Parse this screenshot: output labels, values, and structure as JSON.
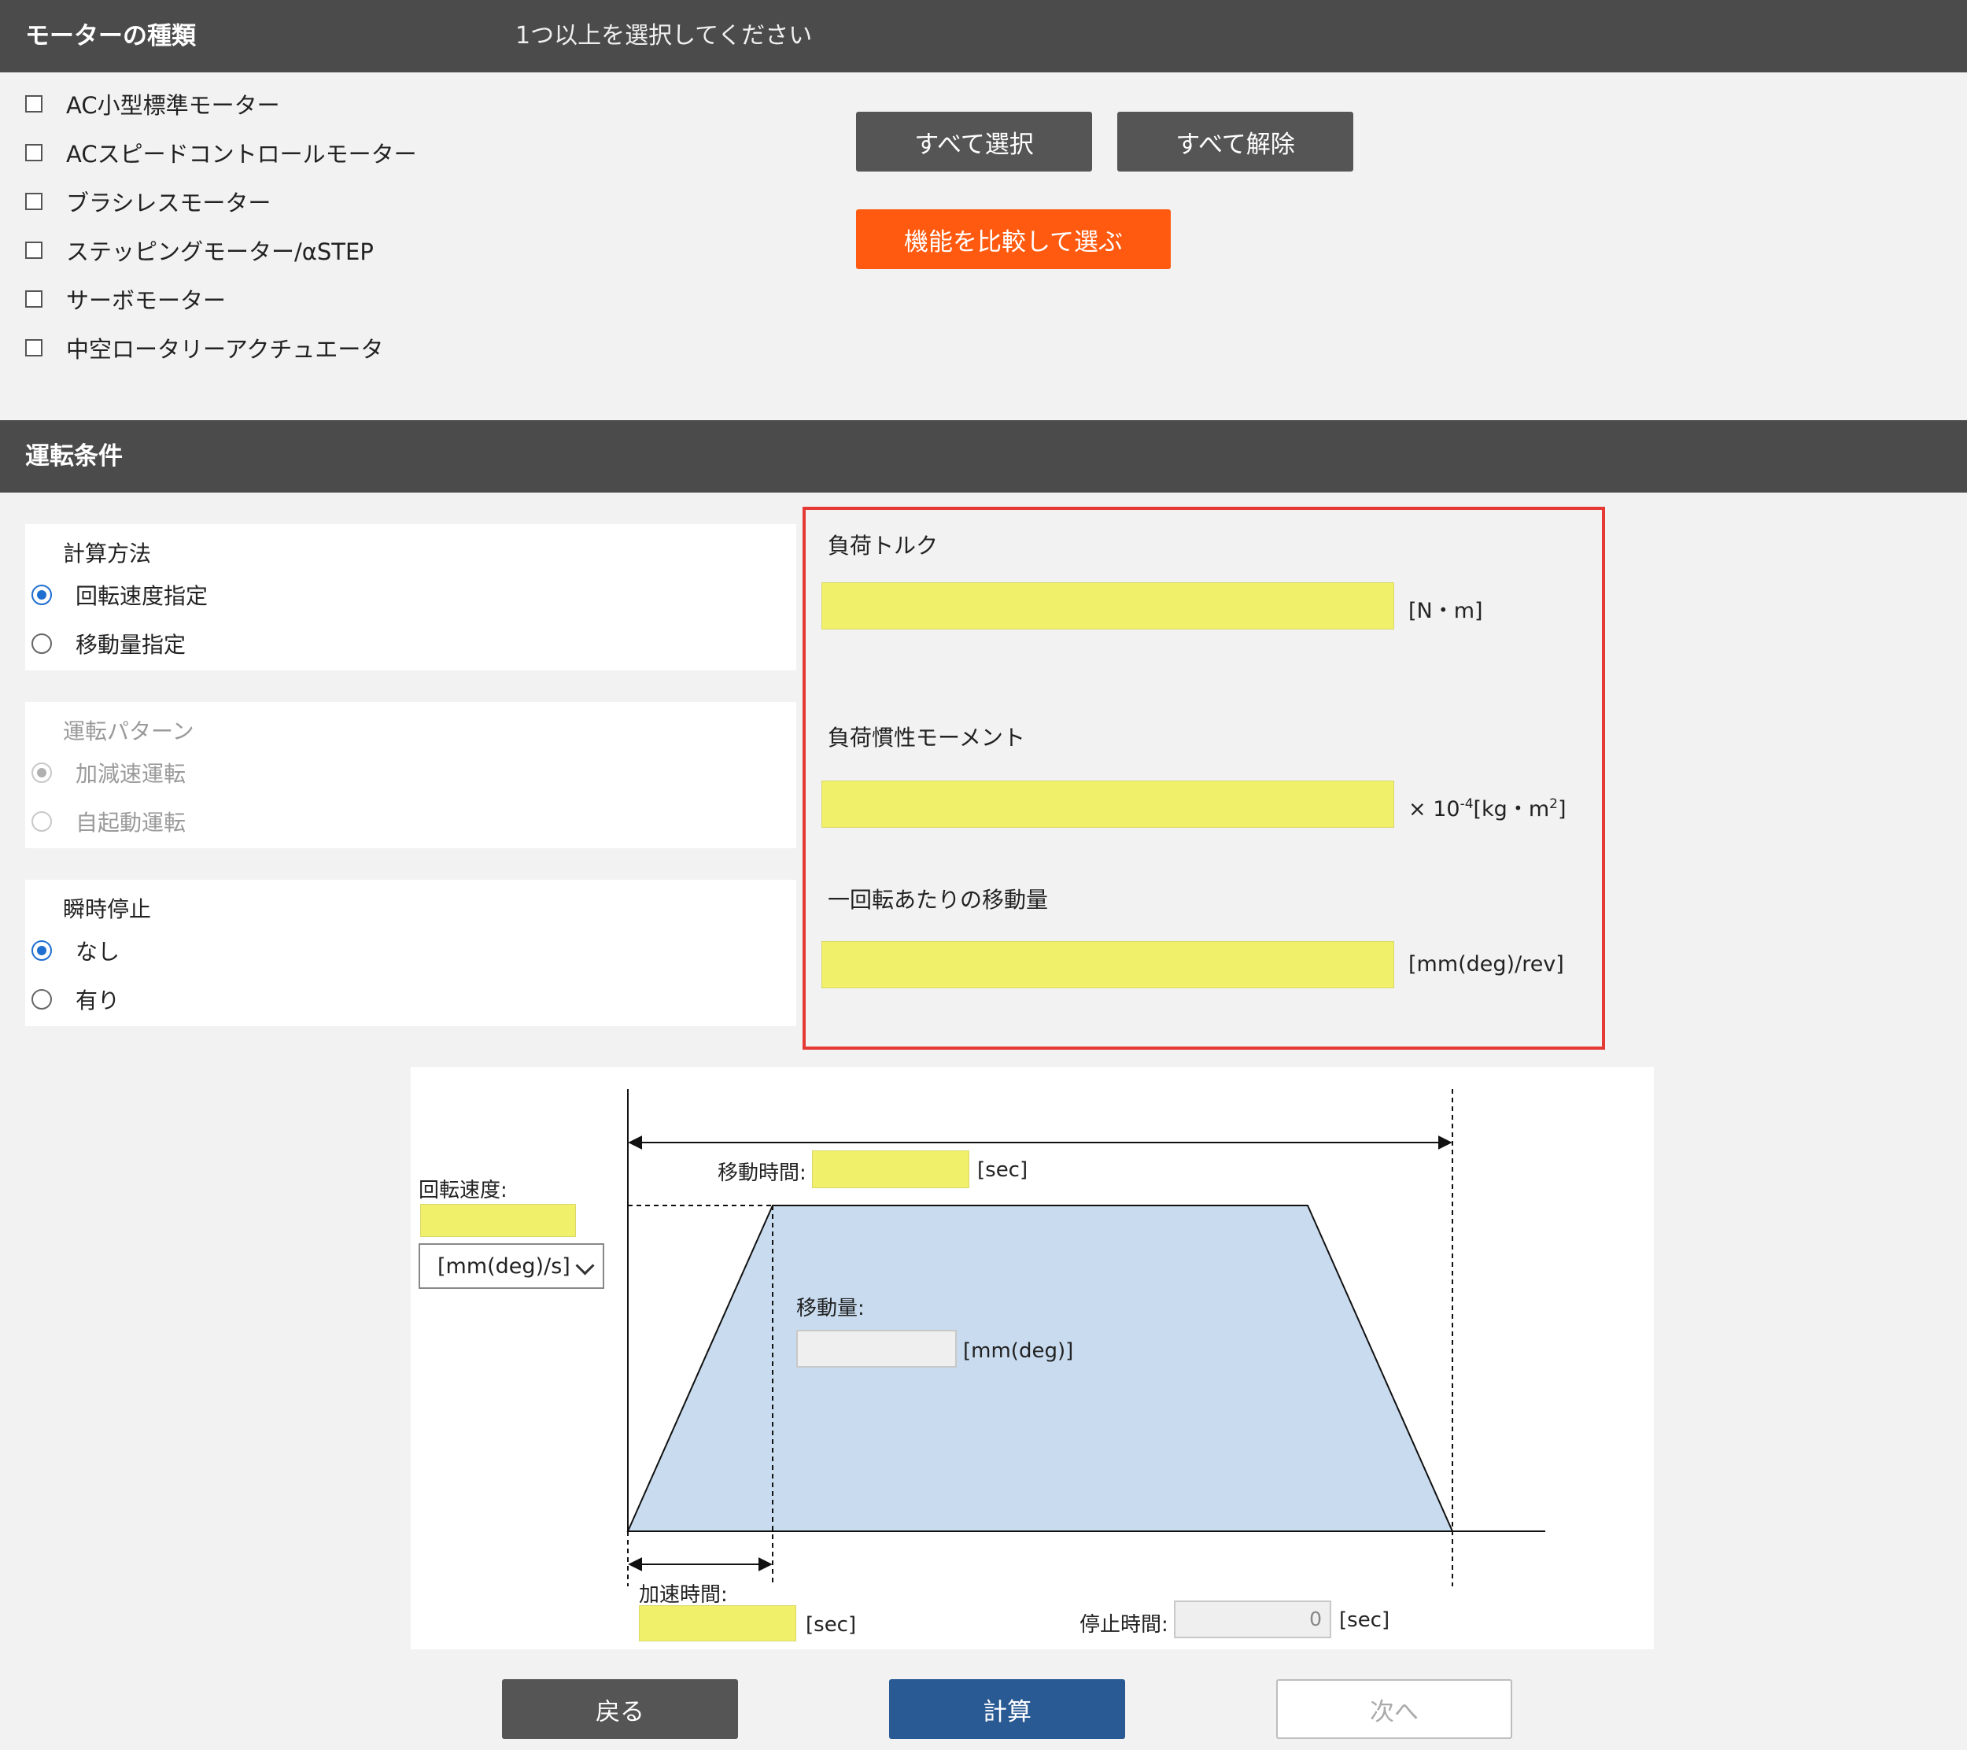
{
  "motor_section": {
    "title": "モーターの種類",
    "hint": "1つ以上を選択してください",
    "options": [
      "AC小型標準モーター",
      "ACスピードコントロールモーター",
      "ブラシレスモーター",
      "ステッピングモーター/αSTEP",
      "サーボモーター",
      "中空ロータリーアクチュエータ"
    ],
    "select_all": "すべて選択",
    "clear_all": "すべて解除",
    "compare": "機能を比較して選ぶ"
  },
  "operation_section": {
    "title": "運転条件",
    "calc_method": {
      "label": "計算方法",
      "options": [
        "回転速度指定",
        "移動量指定"
      ],
      "selected": "回転速度指定"
    },
    "pattern": {
      "label": "運転パターン",
      "options": [
        "加減速運転",
        "自起動運転"
      ],
      "selected": "加減速運転"
    },
    "instant_stop": {
      "label": "瞬時停止",
      "options": [
        "なし",
        "有り"
      ],
      "selected": "なし"
    },
    "load": {
      "torque_label": "負荷トルク",
      "torque_unit": "[N・m]",
      "inertia_label": "負荷慣性モーメント",
      "inertia_unit_prefix": "× 10",
      "inertia_unit_exp": "-4",
      "inertia_unit_mid": "[kg・m",
      "inertia_unit_sq": "2",
      "inertia_unit_end": "]",
      "travel_label": "一回転あたりの移動量",
      "travel_unit": "[mm(deg)/rev]"
    }
  },
  "diagram": {
    "speed_label": "回転速度:",
    "speed_unit_selected": "[mm(deg)/s]",
    "move_time_label": "移動時間:",
    "move_time_unit": "[sec]",
    "distance_label": "移動量:",
    "distance_unit": "[mm(deg)]",
    "accel_label": "加速時間:",
    "accel_unit": "[sec]",
    "stop_label": "停止時間:",
    "stop_value": "0",
    "stop_unit": "[sec]"
  },
  "footer": {
    "back": "戻る",
    "calculate": "計算",
    "next": "次へ"
  },
  "colors": {
    "header_bg": "#4b4b4b",
    "accent_orange": "#ff5a0f",
    "accent_blue": "#2a5a93",
    "input_yellow": "#f0f06b",
    "highlight_red": "#e53935",
    "profile_fill": "#c9dcef"
  }
}
